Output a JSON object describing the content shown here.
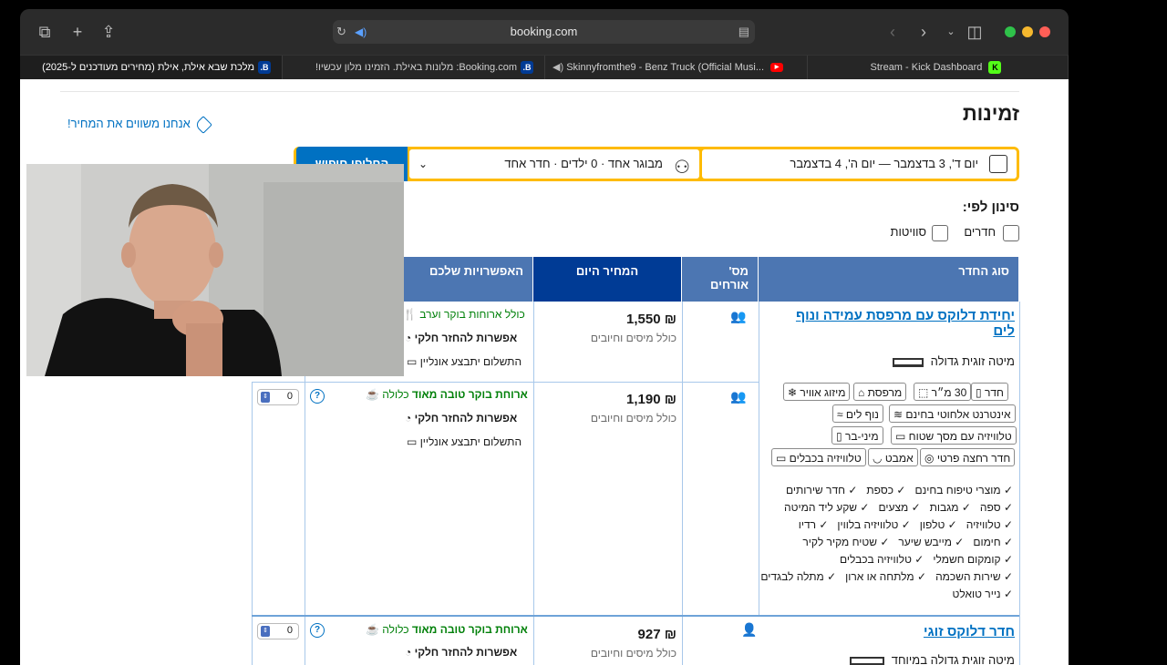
{
  "browser": {
    "url": "booking.com",
    "tabs": [
      {
        "title": "מלכת שבא אילת, אילת (מחירים מעודכנים ל-2025)",
        "favicon": "B."
      },
      {
        "title": "Booking.com: מלונות באילת. הזמינו מלון עכשיו!",
        "favicon": "B."
      },
      {
        "title": "Skinnyfromthe9 - Benz Truck (Official Musi...",
        "favicon": "yt"
      },
      {
        "title": "Stream - Kick Dashboard",
        "favicon": "K"
      }
    ]
  },
  "page": {
    "title": "זמינות",
    "price_match": "אנחנו משווים את המחיר!",
    "search": {
      "dates": "יום ד', 3 בדצמבר — יום ה', 4 בדצמבר",
      "guests": "מבוגר אחד · 0 ילדים · חדר אחד",
      "button": "החליפו חיפוש"
    },
    "filter": {
      "label": "סינון לפי:",
      "options": [
        "חדרים",
        "סוויטות"
      ]
    },
    "table": {
      "headers": [
        "סוג החדר",
        "מס' אורחים",
        "המחיר היום",
        "האפשרויות שלכם"
      ]
    },
    "rooms": [
      {
        "name": "יחידת דלוקס עם מרפסת עמידה ונוף לים",
        "bed": "מיטה זוגית גדולה",
        "chips": [
          "חדר",
          "30 מ״ר",
          "מרפסת",
          "מיזוג אוויר",
          "אינטרנט אלחוטי בחינם",
          "נוף לים",
          "טלוויזיה עם מסך שטוח",
          "מיני-בר",
          "חדר רחצה פרטי",
          "אמבט",
          "טלוויזיה בכבלים"
        ],
        "amenities": [
          "מוצרי טיפוח בחינם",
          "כספת",
          "חדר שירותים",
          "ספה",
          "מגבות",
          "מצעים",
          "שקע ליד המיטה",
          "טלוויזיה",
          "טלפון",
          "טלוויזיה בלווין",
          "רדיו",
          "חימום",
          "מייבש שיער",
          "שטיח מקיר לקיר",
          "קומקום חשמלי",
          "טלוויזיה בכבלים",
          "שירות השכמה",
          "מלתחה או ארון",
          "מתלה לבגדים",
          "נייר טואלט"
        ],
        "offers": [
          {
            "price": "₪ 1,550",
            "taxes": "כולל מיסים וחיובים",
            "meal_note": "כולל ארוחות בוקר וערב",
            "refund": "אפשרות להחזר חלקי",
            "payment": "התשלום יתבצע אונליין"
          },
          {
            "price": "₪ 1,190",
            "taxes": "כולל מיסים וחיובים",
            "meal_strong": "ארוחת בוקר טובה מאוד",
            "meal_rest": " כלולה",
            "refund": "אפשרות להחזר חלקי",
            "payment": "התשלום יתבצע אונליין",
            "select_value": "0"
          }
        ]
      },
      {
        "name": "חדר דלוקס זוגי",
        "bed": "מיטה זוגית גדולה במיוחד",
        "offers": [
          {
            "price": "₪ 927",
            "taxes": "כולל מיסים וחיובים",
            "meal_strong": "ארוחת בוקר טובה מאוד",
            "meal_rest": " כלולה",
            "refund": "אפשרות להחזר חלקי",
            "select_value": "0"
          }
        ]
      }
    ]
  },
  "colors": {
    "header_blue": "#4c76b2",
    "header_dark": "#003b95",
    "link_blue": "#0071c2",
    "search_yellow": "#febb02",
    "green": "#008009"
  }
}
